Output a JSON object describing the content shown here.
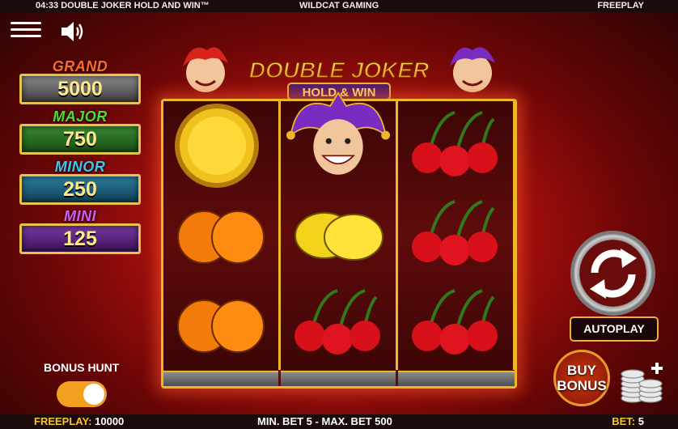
{
  "topbar": {
    "time_title": "04:33 DOUBLE JOKER HOLD AND WIN™",
    "provider": "WILDCAT GAMING",
    "mode": "FREEPLAY"
  },
  "logo": {
    "line1": "DOUBLE JOKER",
    "line2": "HOLD & WIN"
  },
  "jackpots": [
    {
      "label": "GRAND",
      "value": "5000"
    },
    {
      "label": "MAJOR",
      "value": "750"
    },
    {
      "label": "MINOR",
      "value": "250"
    },
    {
      "label": "MINI",
      "value": "125"
    }
  ],
  "reels": [
    [
      "coin",
      "oranges",
      "oranges"
    ],
    [
      "joker",
      "lemons",
      "cherries"
    ],
    [
      "cherries",
      "cherries",
      "cherries"
    ]
  ],
  "controls": {
    "autoplay_label": "AUTOPLAY",
    "buy_line1": "BUY",
    "buy_line2": "BONUS",
    "bonus_hunt_label": "BONUS HUNT",
    "bonus_hunt_on": true
  },
  "bottombar": {
    "freeplay_label": "FREEPLAY:",
    "freeplay_value": "10000",
    "bet_limits": "MIN. BET 5 - MAX. BET 500",
    "bet_label": "BET:",
    "bet_value": "5"
  },
  "icons": [
    "menu-icon",
    "sound-icon",
    "spin-icon",
    "coins-stack-icon"
  ],
  "colors": {
    "accent_gold": "#f0b62a",
    "toggle_orange": "#f3a020"
  }
}
